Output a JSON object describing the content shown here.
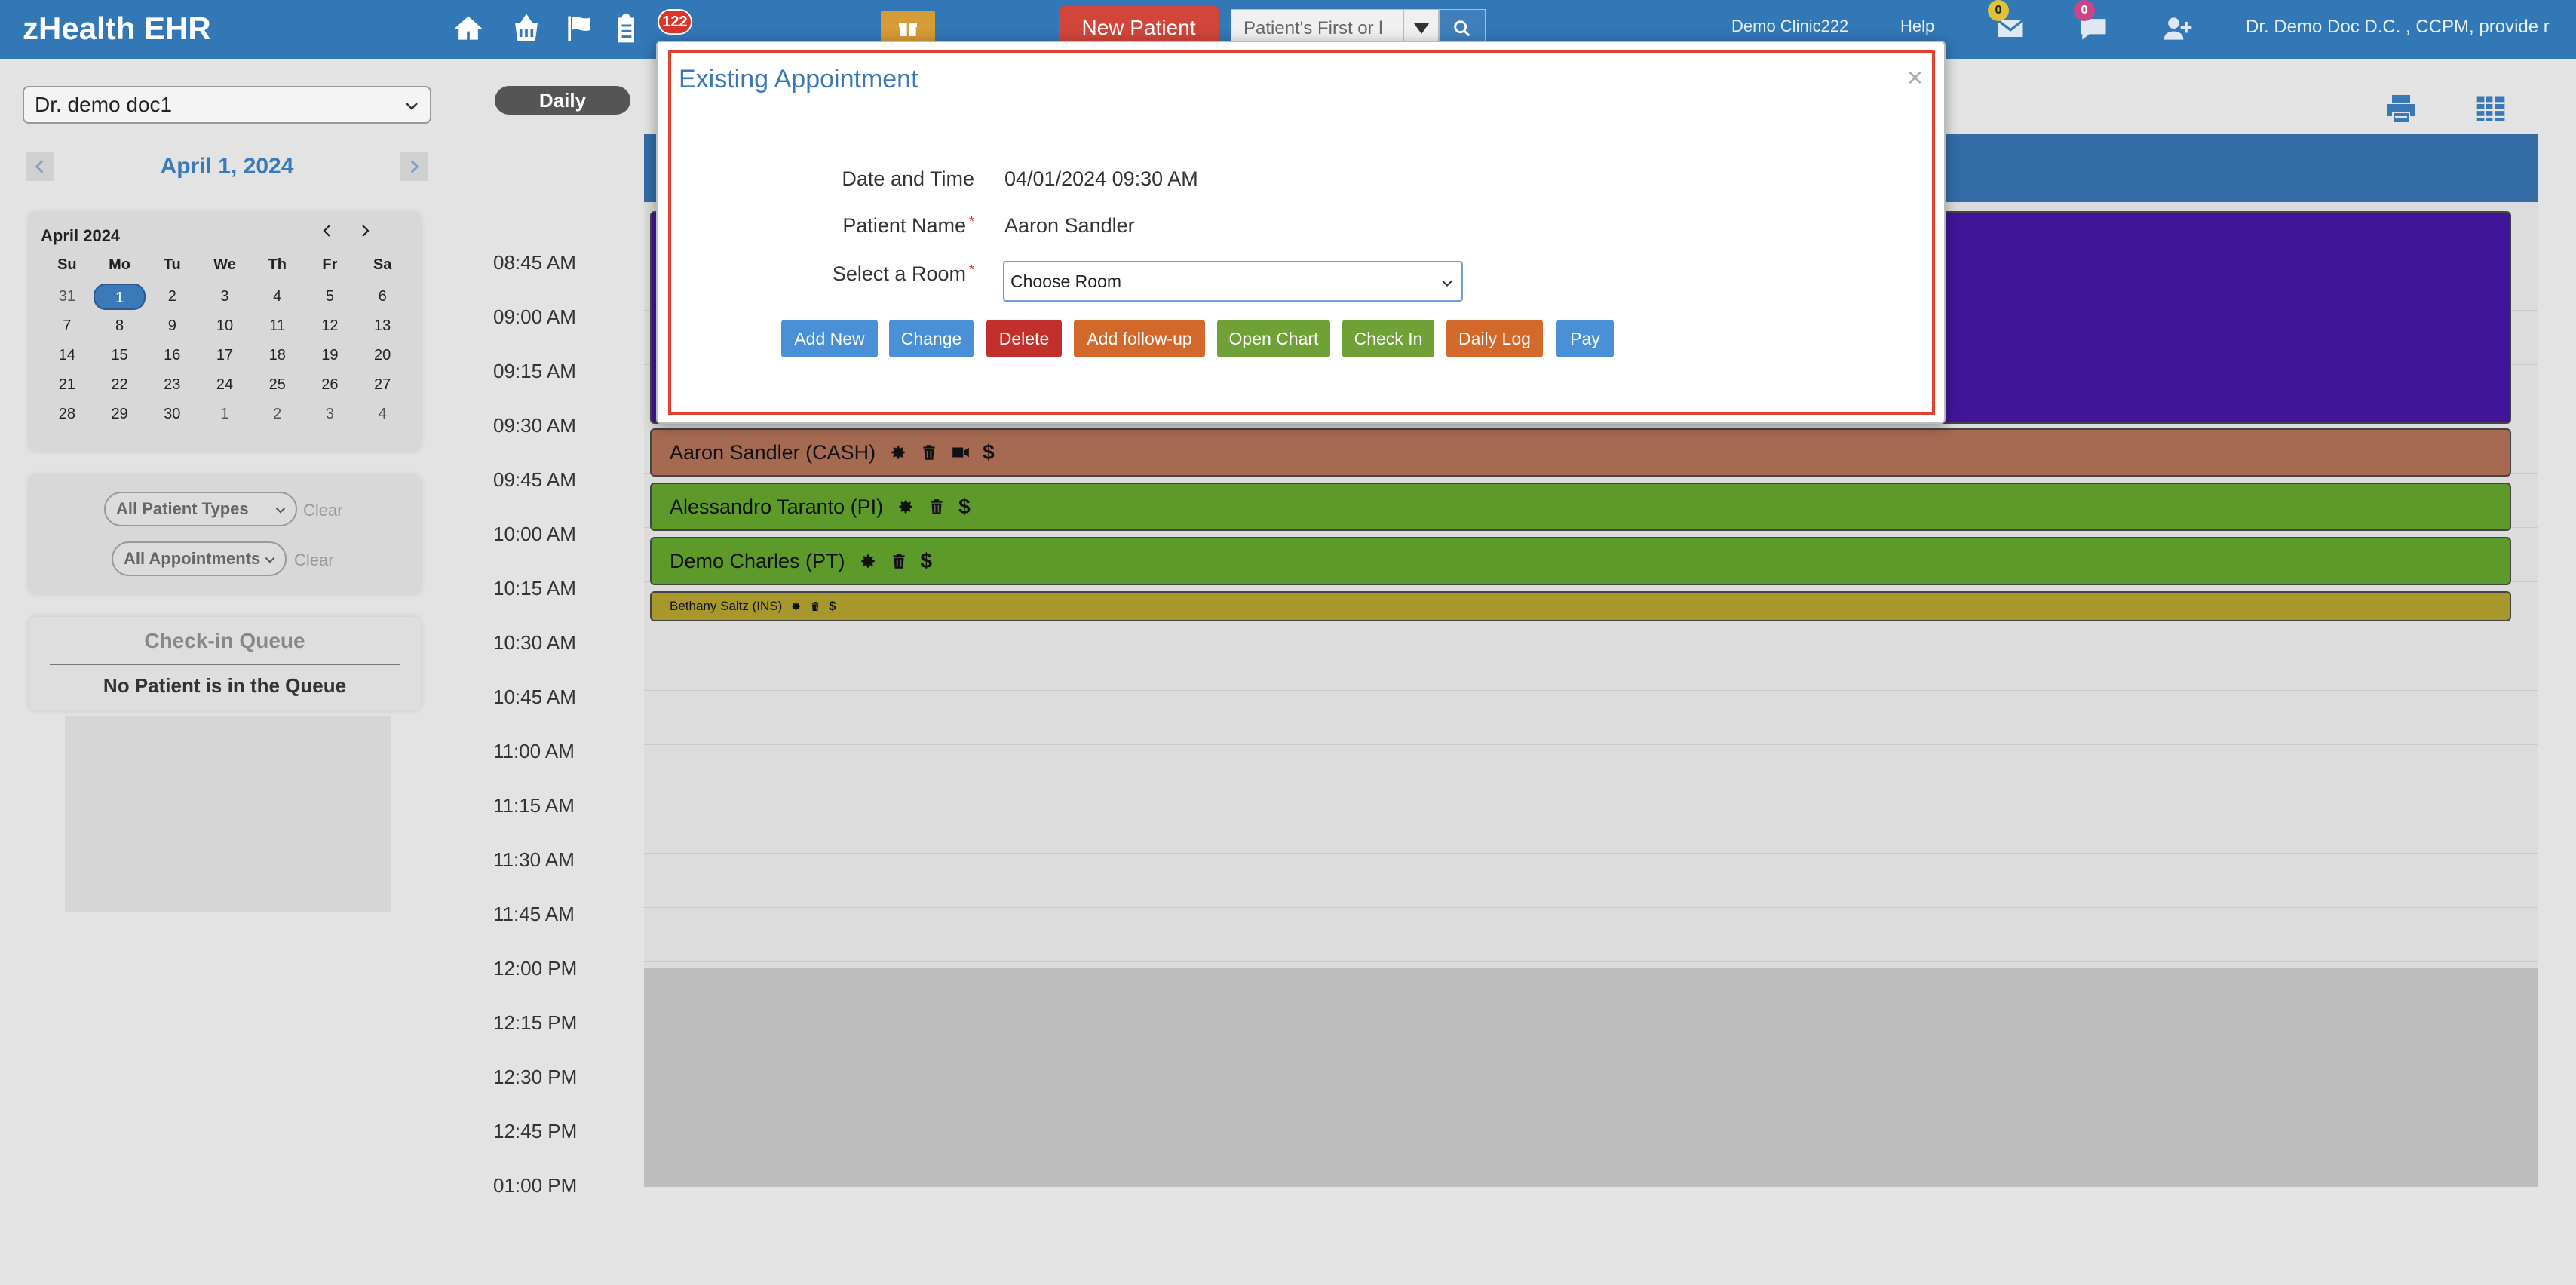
{
  "app": {
    "brand": "zHealth EHR",
    "notification_count": "122"
  },
  "header": {
    "new_patient_label": "New Patient",
    "search_placeholder": "Patient's First or l",
    "clinic": "Demo Clinic222",
    "help": "Help",
    "mail_count": "0",
    "chat_count": "0",
    "user": "Dr. Demo Doc D.C. , CCPM, provide r"
  },
  "sidebar": {
    "provider": "Dr. demo doc1",
    "current_date": "April 1, 2024",
    "calendar": {
      "month": "April 2024",
      "weekdays": [
        "Su",
        "Mo",
        "Tu",
        "We",
        "Th",
        "Fr",
        "Sa"
      ],
      "weeks": [
        [
          "31",
          "1",
          "2",
          "3",
          "4",
          "5",
          "6"
        ],
        [
          "7",
          "8",
          "9",
          "10",
          "11",
          "12",
          "13"
        ],
        [
          "14",
          "15",
          "16",
          "17",
          "18",
          "19",
          "20"
        ],
        [
          "21",
          "22",
          "23",
          "24",
          "25",
          "26",
          "27"
        ],
        [
          "28",
          "29",
          "30",
          "1",
          "2",
          "3",
          "4"
        ]
      ],
      "selected": "1"
    },
    "filters": {
      "patient_types": "All Patient Types",
      "appointments": "All Appointments",
      "clear": "Clear"
    },
    "queue": {
      "title": "Check-in Queue",
      "empty": "No Patient is in the Queue"
    }
  },
  "schedule": {
    "view": "Daily",
    "times": [
      "08:45 AM",
      "09:00 AM",
      "09:15 AM",
      "09:30 AM",
      "09:45 AM",
      "10:00 AM",
      "10:15 AM",
      "10:30 AM",
      "10:45 AM",
      "11:00 AM",
      "11:15 AM",
      "11:30 AM",
      "11:45 AM",
      "12:00 PM",
      "12:15 PM",
      "12:30 PM",
      "12:45 PM",
      "01:00 PM"
    ],
    "appointments": [
      {
        "label": "",
        "color": "#40159a"
      },
      {
        "label": "Aaron Sandler (CASH)",
        "color": "#a66a52"
      },
      {
        "label": "Alessandro Taranto (PI)",
        "color": "#5d9a2a"
      },
      {
        "label": "Demo Charles (PT)",
        "color": "#5d9a2a"
      },
      {
        "label": "Bethany Saltz (INS)",
        "color": "#a8972a"
      }
    ]
  },
  "modal": {
    "title": "Existing Appointment",
    "close": "×",
    "date_time_label": "Date and Time",
    "date_time_value": "04/01/2024 09:30 AM",
    "patient_name_label": "Patient Name",
    "patient_name_value": "Aaron Sandler",
    "room_label": "Select a Room",
    "required_mark": "*",
    "room_value": "Choose Room",
    "buttons": [
      {
        "label": "Add New",
        "color": "#4a90d6"
      },
      {
        "label": "Change",
        "color": "#4a90d6"
      },
      {
        "label": "Delete",
        "color": "#c2302b"
      },
      {
        "label": "Add follow-up",
        "color": "#d2682a"
      },
      {
        "label": "Open Chart",
        "color": "#6fa136"
      },
      {
        "label": "Check In",
        "color": "#6fa136"
      },
      {
        "label": "Daily Log",
        "color": "#d2682a"
      },
      {
        "label": "Pay",
        "color": "#4a90d6"
      }
    ]
  }
}
